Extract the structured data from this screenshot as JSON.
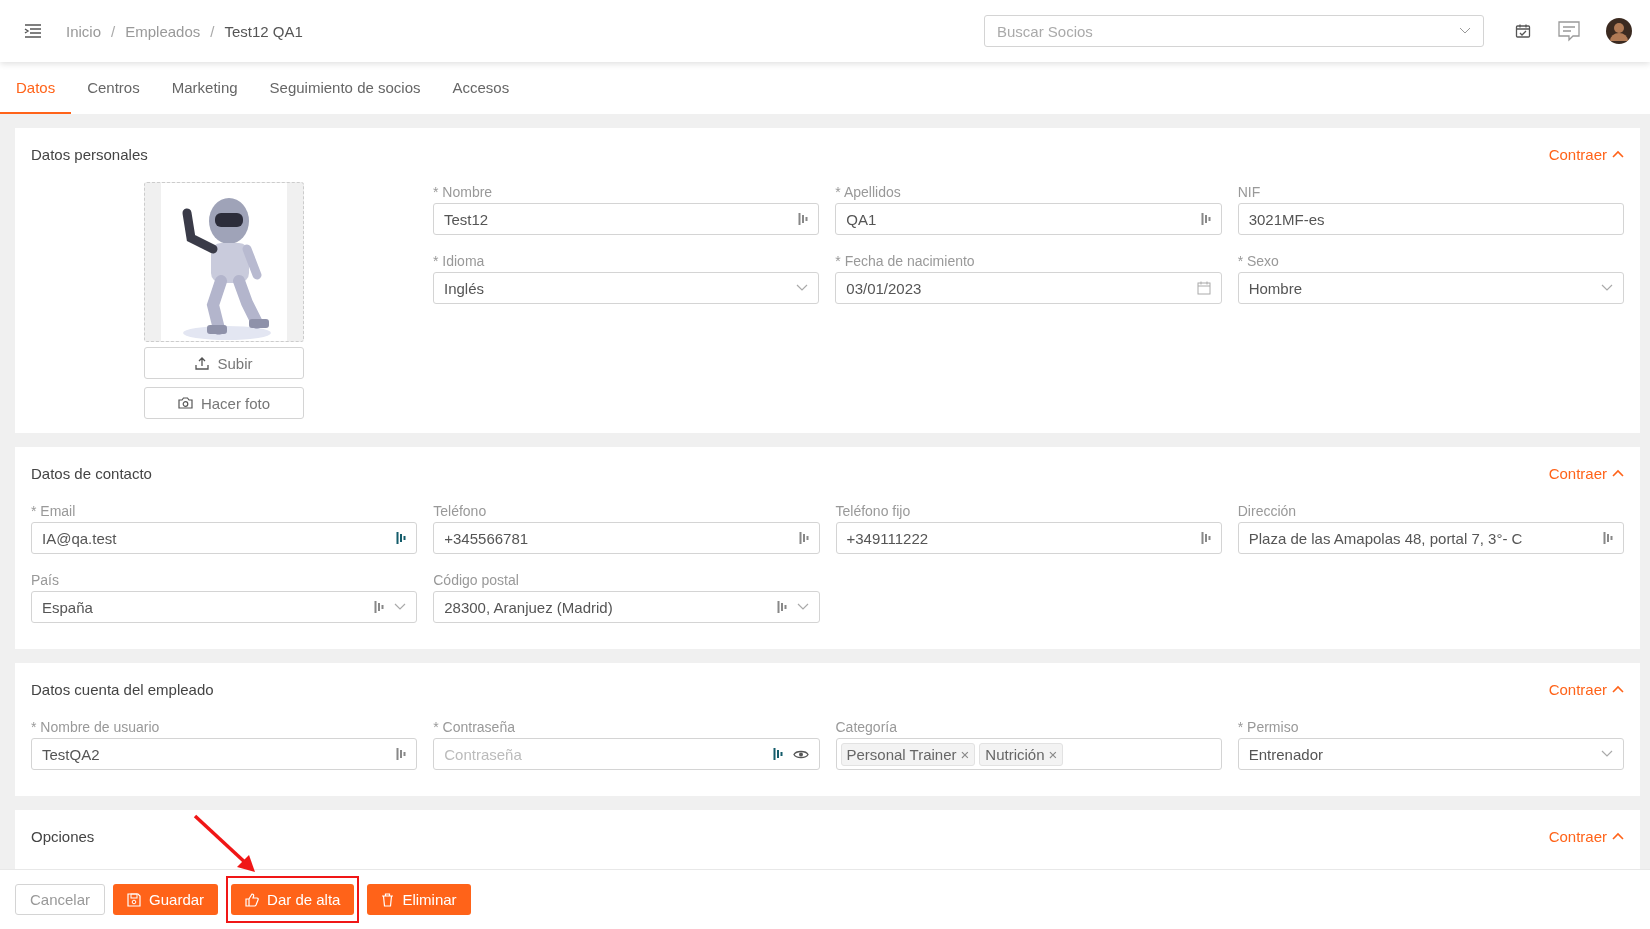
{
  "header": {
    "breadcrumb": [
      "Inicio",
      "Empleados",
      "Test12 QA1"
    ],
    "separator": "/",
    "search": {
      "placeholder": "Buscar Socios"
    }
  },
  "tabs": [
    {
      "label": "Datos",
      "selected": true
    },
    {
      "label": "Centros",
      "selected": false
    },
    {
      "label": "Marketing",
      "selected": false
    },
    {
      "label": "Seguimiento de socios",
      "selected": false
    },
    {
      "label": "Accesos",
      "selected": false
    }
  ],
  "sections": [
    {
      "title": "Datos personales",
      "collapse_label": "Contraer",
      "photo": {
        "kind": "picture",
        "buttons": [
          {
            "label": "Subir",
            "kind": "upload"
          },
          {
            "label": "Hacer foto",
            "kind": "camera"
          }
        ]
      },
      "fields": [
        {
          "label": "* Nombre",
          "kind": "text",
          "value": "Test12",
          "autofill_active": false
        },
        {
          "label": "* Apellidos",
          "kind": "text",
          "value": "QA1",
          "autofill_active": false
        },
        {
          "label": "NIF",
          "kind": "text",
          "value": "3021MF-es"
        },
        {
          "label": "* Idioma",
          "kind": "select",
          "value": "Inglés"
        },
        {
          "label": "* Fecha de nacimiento",
          "kind": "date",
          "value": "03/01/2023"
        },
        {
          "label": "* Sexo",
          "kind": "select",
          "value": "Hombre"
        }
      ]
    },
    {
      "title": "Datos de contacto",
      "collapse_label": "Contraer",
      "fields": [
        {
          "label": "* Email",
          "kind": "text",
          "value": "IA@qa.test",
          "autofill_active": true
        },
        {
          "label": "Teléfono",
          "kind": "text",
          "value": "+345566781",
          "autofill_active": false
        },
        {
          "label": "Teléfono fijo",
          "kind": "text",
          "value": "+349111222",
          "autofill_active": false
        },
        {
          "label": "Dirección",
          "kind": "text",
          "value": "Plaza de las Amapolas 48, portal 7, 3°- C",
          "autofill_active": false
        },
        {
          "label": "País",
          "kind": "select",
          "value": "España",
          "autofill_active": false
        },
        {
          "label": "Código postal",
          "kind": "select",
          "value": "28300, Aranjuez (Madrid)",
          "autofill_active": false
        }
      ]
    },
    {
      "title": "Datos cuenta del empleado",
      "collapse_label": "Contraer",
      "fields": [
        {
          "label": "* Nombre de usuario",
          "kind": "text",
          "value": "TestQA2",
          "autofill_active": false
        },
        {
          "label": "* Contraseña",
          "kind": "password",
          "placeholder": "Contraseña",
          "autofill_active": true
        },
        {
          "label": "Categoría",
          "kind": "tags",
          "tags": [
            {
              "label": "Personal Trainer",
              "remove": "×"
            },
            {
              "label": "Nutrición",
              "remove": "×"
            }
          ]
        },
        {
          "label": "* Permiso",
          "kind": "select",
          "value": "Entrenador"
        }
      ]
    },
    {
      "title": "Opciones",
      "collapse_label": "Contraer"
    }
  ],
  "footer": {
    "buttons": [
      {
        "label": "Cancelar",
        "kind": "cancel",
        "highlighted": false
      },
      {
        "label": "Guardar",
        "kind": "save",
        "highlighted": false
      },
      {
        "label": "Dar de alta",
        "kind": "activate",
        "highlighted": true
      },
      {
        "label": "Eliminar",
        "kind": "delete",
        "highlighted": false
      }
    ]
  }
}
